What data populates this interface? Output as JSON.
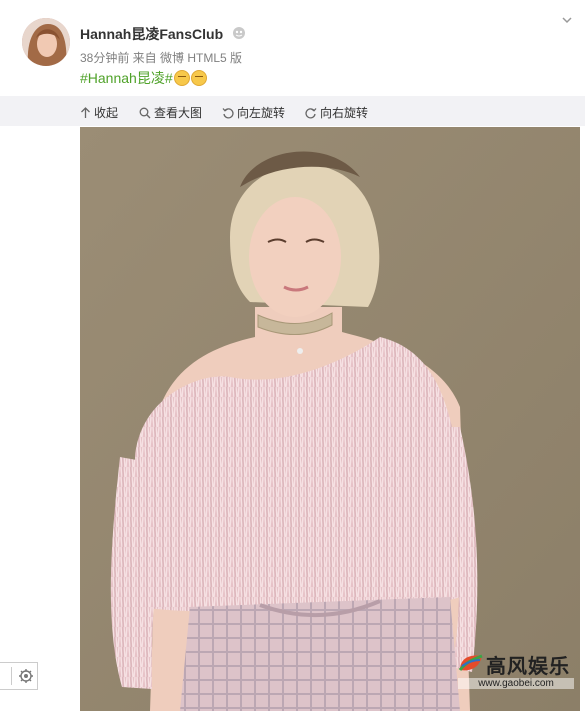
{
  "post": {
    "author": "Hannah昆凌FansClub",
    "meta": "38分钟前 来自 微博 HTML5 版",
    "topic": "#Hannah昆凌#"
  },
  "toolbar": {
    "collapse": "收起",
    "view_large": "查看大图",
    "rotate_left": "向左旋转",
    "rotate_right": "向右旋转"
  },
  "watermark": {
    "brand": "高风娱乐",
    "url": "www.gaobei.com"
  },
  "icons": {
    "vip": "vip-badge-icon",
    "menu": "chevron-down-icon",
    "settings": "gear-icon",
    "emoji": "smirk-emoji-icon"
  },
  "colors": {
    "topic": "#4fa229",
    "toolbar_bg": "#f2f2f5",
    "photo_bg": "#9e8f73"
  }
}
